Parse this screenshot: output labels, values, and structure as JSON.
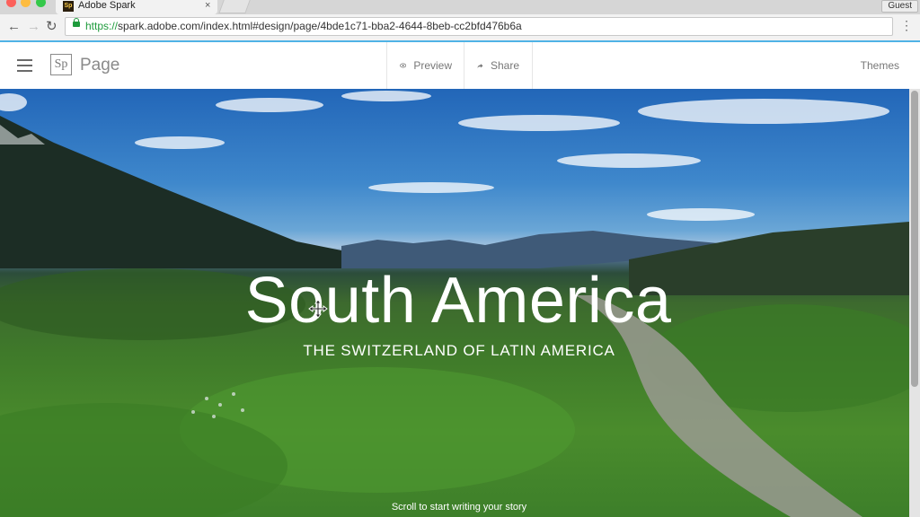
{
  "browser": {
    "tab_title": "Adobe Spark",
    "tab_favicon": "Sp",
    "tab_close": "×",
    "guest_label": "Guest",
    "url_scheme": "https://",
    "url_rest": "spark.adobe.com/index.html#design/page/4bde1c71-bba2-4644-8beb-cc2bfd476b6a",
    "back_icon": "←",
    "forward_icon": "→",
    "reload_icon": "↻",
    "menu_icon": "⋮"
  },
  "app": {
    "logo_text": "Sp",
    "name": "Page",
    "preview_label": "Preview",
    "share_label": "Share",
    "themes_label": "Themes"
  },
  "hero": {
    "title": "South America",
    "subtitle": "THE SWITZERLAND OF LATIN AMERICA",
    "hint": "Scroll to start writing your story"
  },
  "colors": {
    "accent_line": "#4fb3e6",
    "secure_green": "#1e9b3c",
    "sky_blue": "#2266b8",
    "grass_green": "#4a8c2c"
  }
}
